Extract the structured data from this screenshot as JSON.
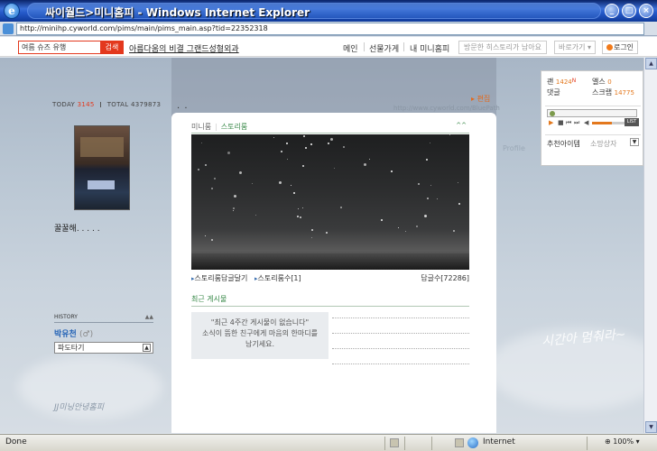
{
  "window": {
    "title": "싸이월드>미니홈피 - Windows Internet Explorer",
    "address": "http://minihp.cyworld.com/pims/main/pims_main.asp?tid=22352318",
    "controls": [
      "_",
      "□",
      "×"
    ]
  },
  "topnav": {
    "search_value": "여름 슈즈 유행",
    "search_button": "검색",
    "promo_link": "아름다움의 비결 그랜드성형외과",
    "items": [
      "메인",
      "선물가게",
      "내 미니홈피"
    ],
    "visitor_history": "방문한 히스토리가 남아요",
    "goto": "바로가기",
    "login": "로그인"
  },
  "profile": {
    "today_label": "TODAY",
    "today_count": "3145",
    "total_label": "TOTAL",
    "total_count": "4379873",
    "mood": "꿀꿀해. . . . .",
    "history_label": "HISTORY",
    "history_arrows": "▲▲",
    "owner_name": "박유천",
    "owner_gender": "(♂)",
    "wave_label": "파도타기",
    "signature": "JJ미닝안녕홈피"
  },
  "header_right": {
    "edit_label": "편집",
    "blog_url": "http://www.cyworld.com/BluePath",
    "ghost_profile": "Profile",
    "dots": ". ."
  },
  "stats": {
    "ilchon_label": "괜",
    "ilchon_count": "1424",
    "new_badge": "N",
    "album_label": "앨스",
    "album_count": "0",
    "comment_label": "댓글",
    "scrap_label": "스크랩",
    "scrap_count": "14775",
    "list_label": "LIST",
    "recommend_label": "추천아이템",
    "sale_label": "소망상자"
  },
  "panel": {
    "tab_minimi": "미니룸",
    "tab_story": "스토리룸",
    "collapse": "^^",
    "story_comment": "스토리룸답글달기",
    "story_count": "스토리룸수[1]",
    "reply_count": "답글수[72286]",
    "recent_title": "최근 게시물",
    "empty_line1": "\"최근 4주간 게시물이 없습니다\"",
    "empty_line2": "소식이 뜸한 친구에게 마음의 한마디를",
    "empty_line3": "남기세요."
  },
  "decor": {
    "handwriting": "시간아 멈춰라~"
  },
  "statusbar": {
    "done": "Done",
    "zone": "Internet",
    "zoom": "100%"
  },
  "colors": {
    "accent_red": "#e3381d",
    "accent_green": "#3a8a4a",
    "accent_orange": "#e3781d",
    "ie_blue": "#2458c8"
  }
}
